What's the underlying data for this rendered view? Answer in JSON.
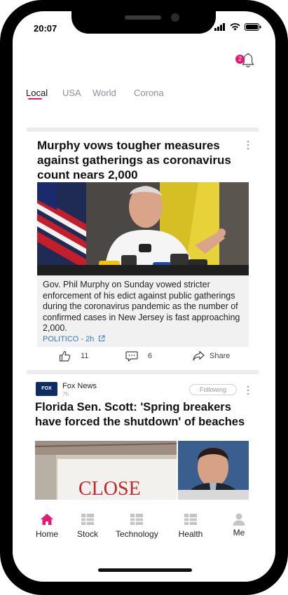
{
  "status_bar": {
    "time": "20:07"
  },
  "notifications": {
    "count": "2"
  },
  "tabs": [
    {
      "label": "Local",
      "active": true
    },
    {
      "label": "USA"
    },
    {
      "label": "World"
    },
    {
      "label": "Corona"
    }
  ],
  "article1": {
    "headline": "Murphy vows tougher measures against gatherings as coronavirus count nears 2,000",
    "summary": "Gov. Phil Murphy on Sunday vowed stricter enforcement of his edict against public gatherings during the coronavirus pandemic as the number of confirmed cases in New Jersey is fast approaching 2,000.",
    "source": "POLITICO - 2h",
    "likes": "11",
    "comments": "6",
    "share_label": "Share"
  },
  "article2": {
    "publisher": "Fox News",
    "publisher_logo_text": "FOX NEWS",
    "time": "7h",
    "follow_label": "Following",
    "headline": "Florida Sen. Scott: 'Spring breakers have forced the shutdown' of beaches",
    "photo_sign_text": "CLOSE"
  },
  "bottom_nav": [
    {
      "label": "Home",
      "icon": "home-icon",
      "active": true
    },
    {
      "label": "Stock",
      "icon": "grid-icon"
    },
    {
      "label": "Technology",
      "icon": "grid-icon"
    },
    {
      "label": "Health",
      "icon": "grid-icon"
    },
    {
      "label": "Me",
      "icon": "person-icon"
    }
  ],
  "colors": {
    "accent": "#e6196e",
    "link": "#2b7bd0",
    "icon_gray": "#c4c4c4"
  }
}
